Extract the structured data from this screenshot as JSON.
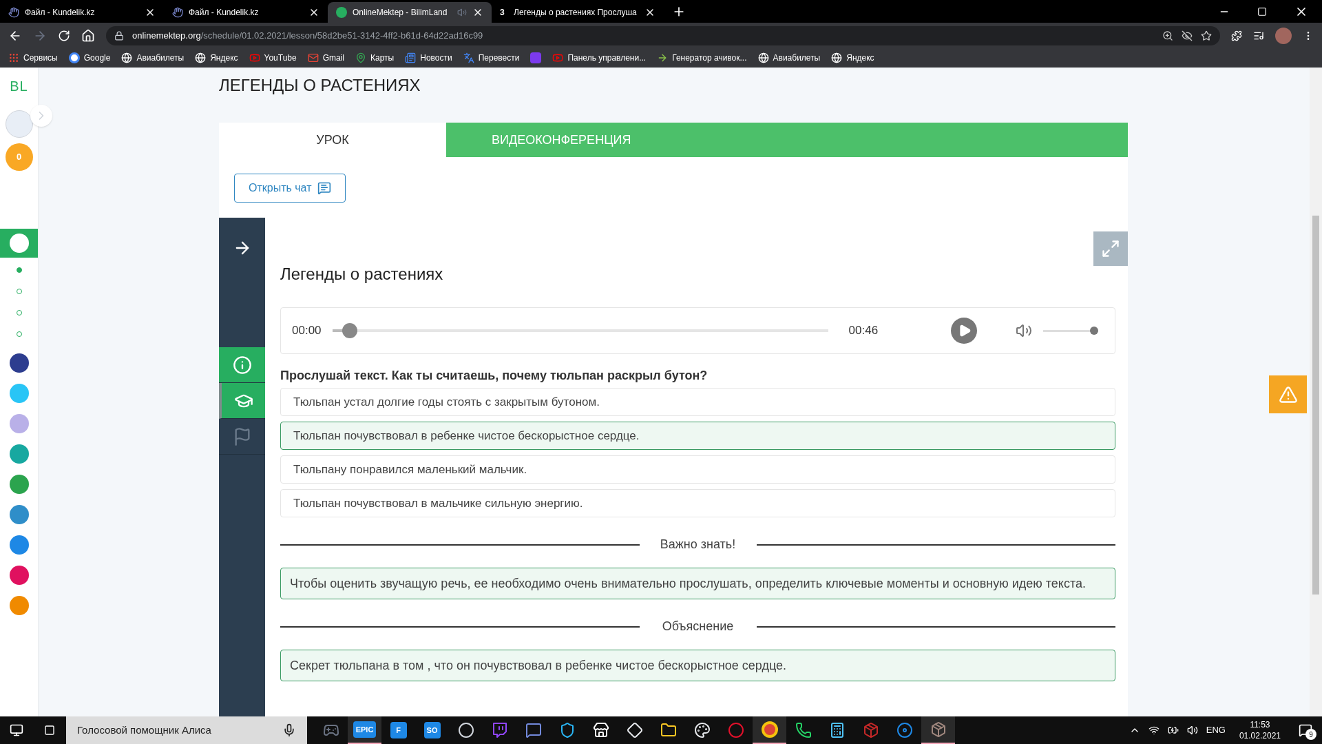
{
  "browser_tabs": [
    {
      "title": "Файл - Kundelik.kz",
      "kind": "hand",
      "selected": false,
      "audio": false
    },
    {
      "title": "Файл - Kundelik.kz",
      "kind": "hand",
      "selected": false,
      "audio": false
    },
    {
      "title": "OnlineMektep - BilimLand",
      "kind": "site",
      "selected": true,
      "audio": true
    },
    {
      "title": "Легенды о растениях Прослуша",
      "favicon_text": "3",
      "kind": "text",
      "selected": false,
      "audio": false
    }
  ],
  "address": {
    "host": "onlinemektep.org",
    "path": "/schedule/01.02.2021/lesson/58d2be51-3142-4ff2-b61d-64d22ad16c99"
  },
  "bookmarks": [
    {
      "label": "Сервисы",
      "kind": "apps"
    },
    {
      "label": "Google",
      "kind": "google"
    },
    {
      "label": "Авиабилеты",
      "kind": "globe"
    },
    {
      "label": "Яндекс",
      "kind": "globe"
    },
    {
      "label": "YouTube",
      "kind": "youtube"
    },
    {
      "label": "Gmail",
      "kind": "gmail"
    },
    {
      "label": "Карты",
      "kind": "maps"
    },
    {
      "label": "Новости",
      "kind": "news"
    },
    {
      "label": "Перевести",
      "kind": "translate"
    },
    {
      "kind": "square"
    },
    {
      "label": "Панель управлени...",
      "kind": "youtube"
    },
    {
      "label": "Генератор ачивок...",
      "kind": "arrow"
    },
    {
      "label": "Авиабилеты",
      "kind": "globe"
    },
    {
      "label": "Яндекс",
      "kind": "globe"
    }
  ],
  "sidebar": {
    "logo": "BL",
    "coins": "0",
    "steps": [
      {
        "selected": true
      },
      {
        "selected": false
      },
      {
        "selected": false
      },
      {
        "selected": false
      }
    ],
    "apps": [
      {
        "color": "#2d3d8f"
      },
      {
        "color": "#29c5f6"
      },
      {
        "color": "#b9b0e8"
      },
      {
        "color": "#17a8a0"
      },
      {
        "color": "#2ba44e"
      },
      {
        "color": "#2f8ec9"
      },
      {
        "color": "#1e88e5"
      },
      {
        "color": "#e0115f"
      },
      {
        "color": "#f08a00"
      }
    ]
  },
  "page_title": "ЛЕГЕНДЫ О РАСТЕНИЯХ",
  "lesson_tabs": [
    {
      "label": "УРОК",
      "selected": true
    },
    {
      "label": "ВИДЕОКОНФЕРЕНЦИЯ",
      "selected": false
    }
  ],
  "chat_button": "Открыть чат",
  "lesson_nav": [
    {
      "kind": "info",
      "active": true,
      "current": false
    },
    {
      "kind": "cap",
      "active": true,
      "current": true
    },
    {
      "kind": "flag",
      "active": false,
      "current": false
    }
  ],
  "lesson": {
    "heading": "Легенды о растениях",
    "player": {
      "time": "00:00",
      "duration": "00:46",
      "level": 0.05,
      "volume": {
        "level": 1
      }
    },
    "question": "Прослушай текст. Как ты считаешь, почему тюльпан раскрыл бутон?",
    "options": [
      {
        "text": "Тюльпан устал долгие годы стоять с закрытым бутоном.",
        "selected": false
      },
      {
        "text": "Тюльпан почувствовал в ребенке чистое бескорыстное сердце.",
        "selected": true
      },
      {
        "text": "Тюльпану понравился маленький мальчик.",
        "selected": false
      },
      {
        "text": "Тюльпан почувствовал в мальчике сильную энергию.",
        "selected": false
      }
    ],
    "sections": [
      {
        "title": "Важно знать!",
        "text": "Чтобы оценить звучащую речь, ее необходимо очень внимательно прослушать, определить ключевые моменты и основную идею текста."
      },
      {
        "title": "Объяснение",
        "text": "Секрет тюльпана в том , что он почувствовал в ребенке чистое бескорыстное сердце."
      }
    ]
  },
  "taskbar": {
    "search_placeholder": "Голосовой помощник Алиса",
    "apps": [
      {
        "kind": "gamepad",
        "running": false
      },
      {
        "kind": "text",
        "label": "EPIC",
        "running": true
      },
      {
        "kind": "text",
        "label": "F",
        "running": false
      },
      {
        "kind": "text",
        "label": "SO",
        "running": false
      },
      {
        "kind": "obs",
        "running": false
      },
      {
        "kind": "twitch",
        "running": false
      },
      {
        "kind": "discord",
        "running": false
      },
      {
        "kind": "vpn",
        "running": false
      },
      {
        "kind": "store",
        "running": false
      },
      {
        "kind": "diamond",
        "running": false
      },
      {
        "kind": "folder",
        "running": false
      },
      {
        "kind": "paint",
        "running": false
      },
      {
        "kind": "opera",
        "running": false
      },
      {
        "kind": "chrome",
        "running": true
      },
      {
        "kind": "whatsapp",
        "running": false
      },
      {
        "kind": "calc",
        "running": false
      },
      {
        "kind": "rar",
        "running": false
      },
      {
        "kind": "disc",
        "running": false
      },
      {
        "kind": "box",
        "running": true
      }
    ],
    "language": "ENG",
    "time": "11:53",
    "date": "01.02.2021",
    "notifications": "9"
  }
}
